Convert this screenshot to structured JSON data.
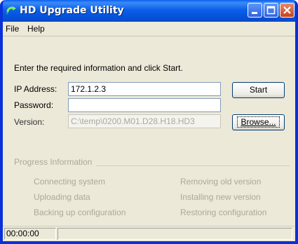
{
  "window": {
    "title": "HD Upgrade Utility"
  },
  "menu": {
    "items": [
      "File",
      "Help"
    ]
  },
  "form": {
    "instruction": "Enter the required information and click Start.",
    "ip_label": "IP Address:",
    "ip_value": "172.1.2.3",
    "password_label": "Password:",
    "password_value": "",
    "version_label": "Version:",
    "version_value": "C:\\temp\\0200.M01.D28.H18.HD3",
    "start_label": "Start",
    "browse_label": "Browse..."
  },
  "progress": {
    "title": "Progress Information",
    "left_items": [
      "Connecting system",
      "Uploading data",
      "Backing up configuration"
    ],
    "right_items": [
      "Removing old version",
      "Installing new version",
      "Restoring configuration"
    ]
  },
  "statusbar": {
    "time": "00:00:00"
  },
  "colors": {
    "title_bar": "#0553dc",
    "disabled_text": "#aca899",
    "window_bg": "#ece9d8"
  }
}
